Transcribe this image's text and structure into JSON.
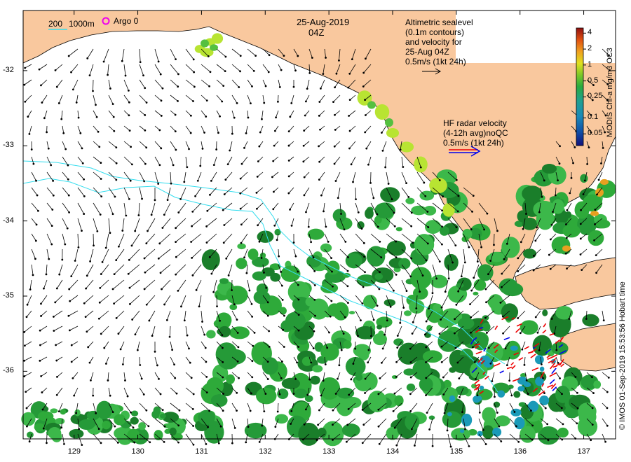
{
  "title": {
    "date": "25-Aug-2019",
    "time": "04Z"
  },
  "legend": {
    "depth_200": "200",
    "depth_1000": "1000m",
    "argo": "Argo 0"
  },
  "altimetry_note": {
    "lines": [
      "Altimetric sealevel",
      "(0.1m contours)",
      "and velocity for",
      "25-Aug 04Z",
      "0.5m/s (1kt 24h)"
    ]
  },
  "hf_radar_note": {
    "lines": [
      "HF radar velocity",
      "(4-12h avg)noQC",
      "0.5m/s (1kt 24h)"
    ]
  },
  "colorbar": {
    "title": "MODIS Chl-a mg/m3 OC3",
    "ticks": [
      "4",
      "2",
      "1",
      "0.5",
      "0.25",
      "0.1",
      "0.05"
    ],
    "tick_values": [
      4,
      2,
      1,
      0.5,
      0.25,
      0.1,
      0.05
    ],
    "range": [
      0.03,
      5
    ]
  },
  "axes": {
    "x_ticks": [
      "129",
      "130",
      "131",
      "132",
      "133",
      "134",
      "135",
      "136",
      "137"
    ],
    "x_values": [
      129,
      130,
      131,
      132,
      133,
      134,
      135,
      136,
      137
    ],
    "y_ticks": [
      "-32",
      "-33",
      "-34",
      "-35",
      "-36"
    ],
    "y_values": [
      -32,
      -33,
      -34,
      -35,
      -36
    ],
    "lon_range": [
      128.2,
      137.5
    ],
    "lat_range": [
      -31.2,
      -36.9
    ]
  },
  "credit": "© IMOS 01-Sep-2019 15:53:56 Hobart time",
  "colors": {
    "land": "#f9c89e",
    "isobath": "#33ddee",
    "argo": "#ee00ee",
    "hf_red": "#ee0000",
    "hf_blue": "#0000ee",
    "chl_green": "#2eaa3a",
    "chl_dark": "#1a7e2a",
    "chl_yellow": "#b8e432"
  }
}
